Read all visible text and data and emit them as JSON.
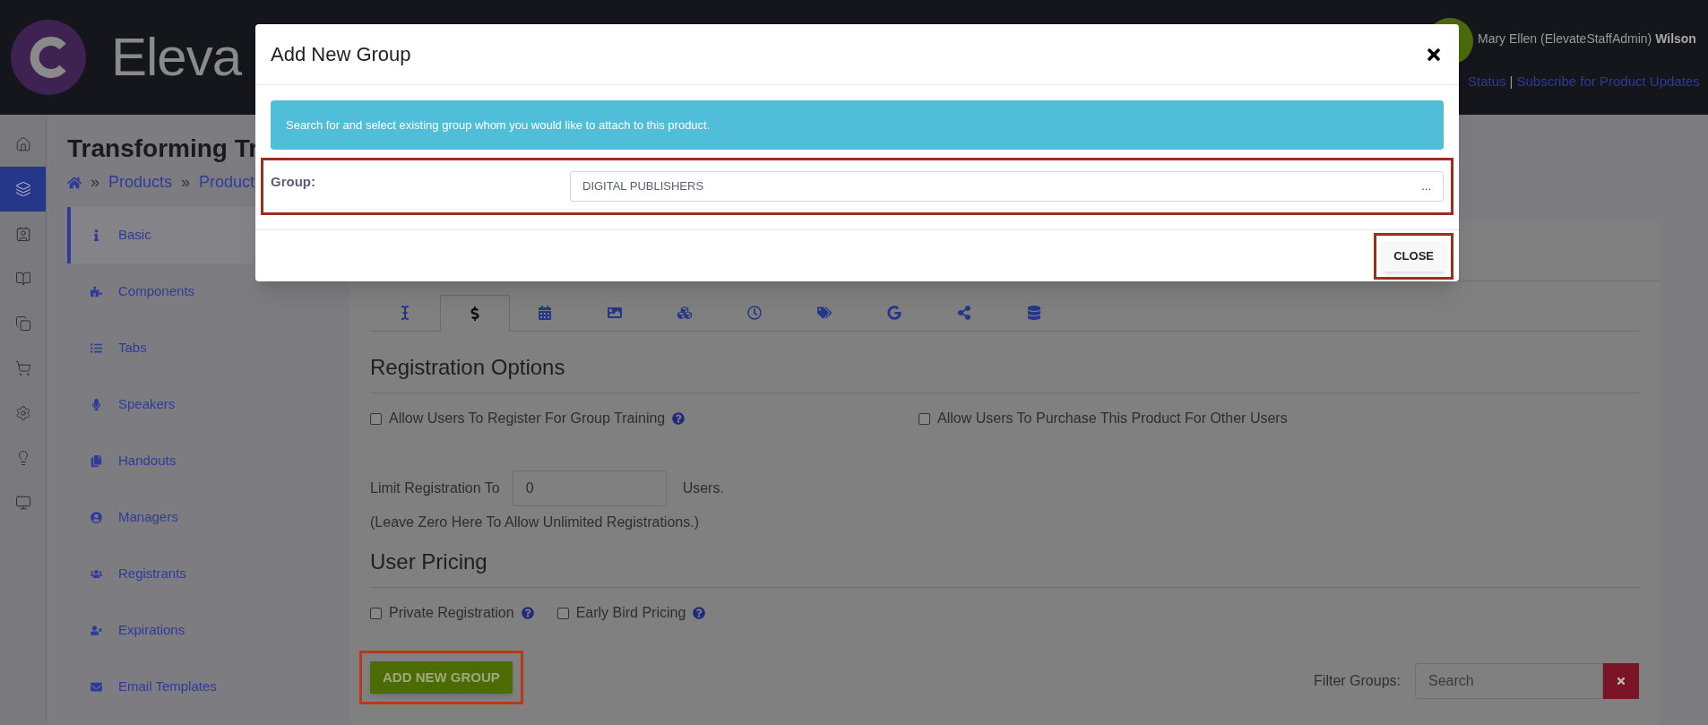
{
  "header": {
    "logo_text": "Eleva",
    "user_name": "Mary Ellen (ElevateStaffAdmin)",
    "user_surname": "Wilson",
    "links": [
      "Status",
      "Subscribe for Product Updates"
    ],
    "link_separator": "|"
  },
  "rail": [
    {
      "kind": "home",
      "selected": false
    },
    {
      "kind": "layers",
      "selected": true
    },
    {
      "kind": "contact",
      "selected": false
    },
    {
      "kind": "book",
      "selected": false
    },
    {
      "kind": "copy",
      "selected": false
    },
    {
      "kind": "cart",
      "selected": false
    },
    {
      "kind": "settings",
      "selected": false
    },
    {
      "kind": "bulb",
      "selected": false
    },
    {
      "kind": "monitor",
      "selected": false
    }
  ],
  "page": {
    "title": "Transforming Tr",
    "breadcrumb": [
      "Products",
      "Product"
    ],
    "breadcrumb_separator": "»"
  },
  "nav": [
    {
      "label": "Basic",
      "kind": "info",
      "selected": true
    },
    {
      "label": "Components",
      "kind": "puzzle",
      "selected": false
    },
    {
      "label": "Tabs",
      "kind": "list",
      "selected": false
    },
    {
      "label": "Speakers",
      "kind": "mic",
      "selected": false
    },
    {
      "label": "Handouts",
      "kind": "copy",
      "selected": false
    },
    {
      "label": "Managers",
      "kind": "user",
      "selected": false
    },
    {
      "label": "Registrants",
      "kind": "users",
      "selected": false
    },
    {
      "label": "Expirations",
      "kind": "user-x",
      "selected": false
    },
    {
      "label": "Email Templates",
      "kind": "mail",
      "selected": false
    }
  ],
  "tabs": [
    {
      "kind": "cursor",
      "selected": false
    },
    {
      "kind": "dollar",
      "selected": true
    },
    {
      "kind": "calendar",
      "selected": false
    },
    {
      "kind": "image",
      "selected": false
    },
    {
      "kind": "cubes",
      "selected": false
    },
    {
      "kind": "clock",
      "selected": false
    },
    {
      "kind": "tags",
      "selected": false
    },
    {
      "kind": "google",
      "selected": false
    },
    {
      "kind": "share",
      "selected": false
    },
    {
      "kind": "database",
      "selected": false
    }
  ],
  "registration": {
    "heading": "Registration Options",
    "options": [
      {
        "label": "Allow Users To Register For Group Training",
        "checked": false,
        "help": true
      },
      {
        "label": "Allow Users To Purchase This Product For Other Users",
        "checked": false,
        "help": false
      }
    ],
    "limit_label": "Limit Registration To",
    "limit_value": "0",
    "limit_unit": "Users.",
    "limit_note": "(Leave Zero Here To Allow Unlimited Registrations.)"
  },
  "pricing": {
    "heading": "User Pricing",
    "options": [
      {
        "label": "Private Registration",
        "checked": false,
        "help": true
      },
      {
        "label": "Early Bird Pricing",
        "checked": false,
        "help": true
      }
    ]
  },
  "add_button": {
    "label": "ADD NEW GROUP",
    "highlighted": true
  },
  "filter": {
    "label": "Filter Groups:",
    "placeholder": "Search"
  },
  "modal": {
    "title": "Add New Group",
    "info": "Search for and select existing group whom you would like to attach to this product.",
    "field_label": "Group:",
    "field_value": "DIGITAL PUBLISHERS",
    "field_more": "...",
    "field_highlighted": true,
    "close_label": "CLOSE",
    "close_highlighted": true
  }
}
